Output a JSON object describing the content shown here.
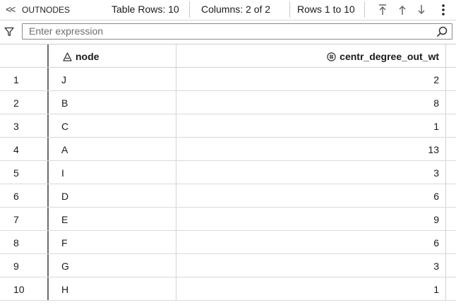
{
  "toolbar": {
    "back_glyph": "<<",
    "title": "OUTNODES",
    "table_rows": "Table Rows: 10",
    "columns": "Columns: 2 of 2",
    "rows_range": "Rows 1 to 10"
  },
  "filter": {
    "placeholder": "Enter expression",
    "value": ""
  },
  "columns": [
    {
      "label": "node",
      "icon": "character-type-icon"
    },
    {
      "label": "centr_degree_out_wt",
      "icon": "numeric-type-icon"
    }
  ],
  "rows": [
    {
      "num": "1",
      "node": "J",
      "value": "2"
    },
    {
      "num": "2",
      "node": "B",
      "value": "8"
    },
    {
      "num": "3",
      "node": "C",
      "value": "1"
    },
    {
      "num": "4",
      "node": "A",
      "value": "13"
    },
    {
      "num": "5",
      "node": "I",
      "value": "3"
    },
    {
      "num": "6",
      "node": "D",
      "value": "6"
    },
    {
      "num": "7",
      "node": "E",
      "value": "9"
    },
    {
      "num": "8",
      "node": "F",
      "value": "6"
    },
    {
      "num": "9",
      "node": "G",
      "value": "3"
    },
    {
      "num": "10",
      "node": "H",
      "value": "1"
    }
  ]
}
